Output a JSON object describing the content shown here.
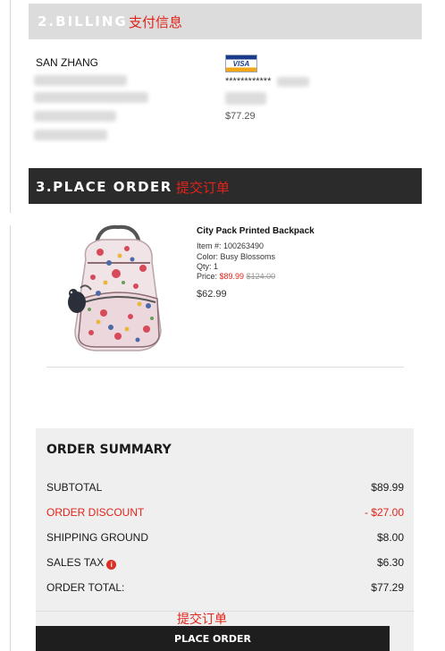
{
  "billing": {
    "title": "2.BILLING",
    "annotation_cn": "支付信息",
    "name": "SAN ZHANG",
    "card_icon": "visa-card-icon",
    "card_brand": "VISA",
    "card_masked": "************",
    "amount": "$77.29"
  },
  "place_order_section": {
    "title": "3.PLACE ORDER",
    "annotation_cn": "提交订单"
  },
  "product": {
    "name": "City Pack Printed Backpack",
    "item": "Item #: 100263490",
    "color": "Color: Busy Blossoms",
    "qty": "Qty: 1",
    "price_label": "Price: ",
    "sale_price": "$89.99",
    "original_price": "$124.00",
    "total": "$62.99"
  },
  "summary": {
    "title": "ORDER SUMMARY",
    "rows": [
      {
        "label": "SUBTOTAL",
        "value": "$89.99"
      },
      {
        "label": "ORDER DISCOUNT",
        "value": "- $27.00"
      },
      {
        "label": "SHIPPING GROUND",
        "value": "$8.00"
      },
      {
        "label": "SALES TAX",
        "value": "$6.30"
      },
      {
        "label": "ORDER TOTAL:",
        "value": "$77.29"
      }
    ]
  },
  "footer": {
    "annotation_cn": "提交订单",
    "button_label": "PLACE ORDER"
  },
  "colors": {
    "accent_red": "#e2231a",
    "header_dark": "#2b2b2b",
    "header_light": "#dcdcdc"
  }
}
